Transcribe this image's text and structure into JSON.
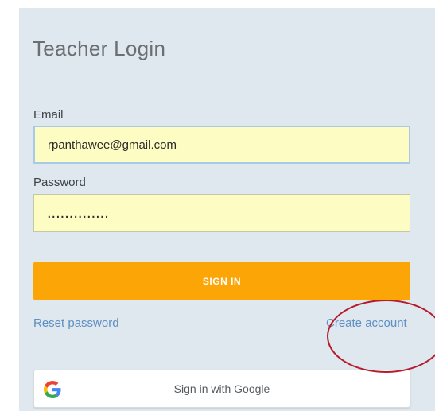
{
  "login": {
    "title": "Teacher Login",
    "email_label": "Email",
    "email_value": "rpanthawee@gmail.com",
    "password_label": "Password",
    "password_value": "..............",
    "signin_label": "SIGN IN",
    "reset_label": "Reset password",
    "create_label": "Create account",
    "google_label": "Sign in with Google"
  },
  "colors": {
    "panel_bg": "#dfe7ef",
    "input_bg": "#fdfdc3",
    "accent": "#fca506",
    "link": "#5d8fc3",
    "annotation": "#b51c2b"
  }
}
